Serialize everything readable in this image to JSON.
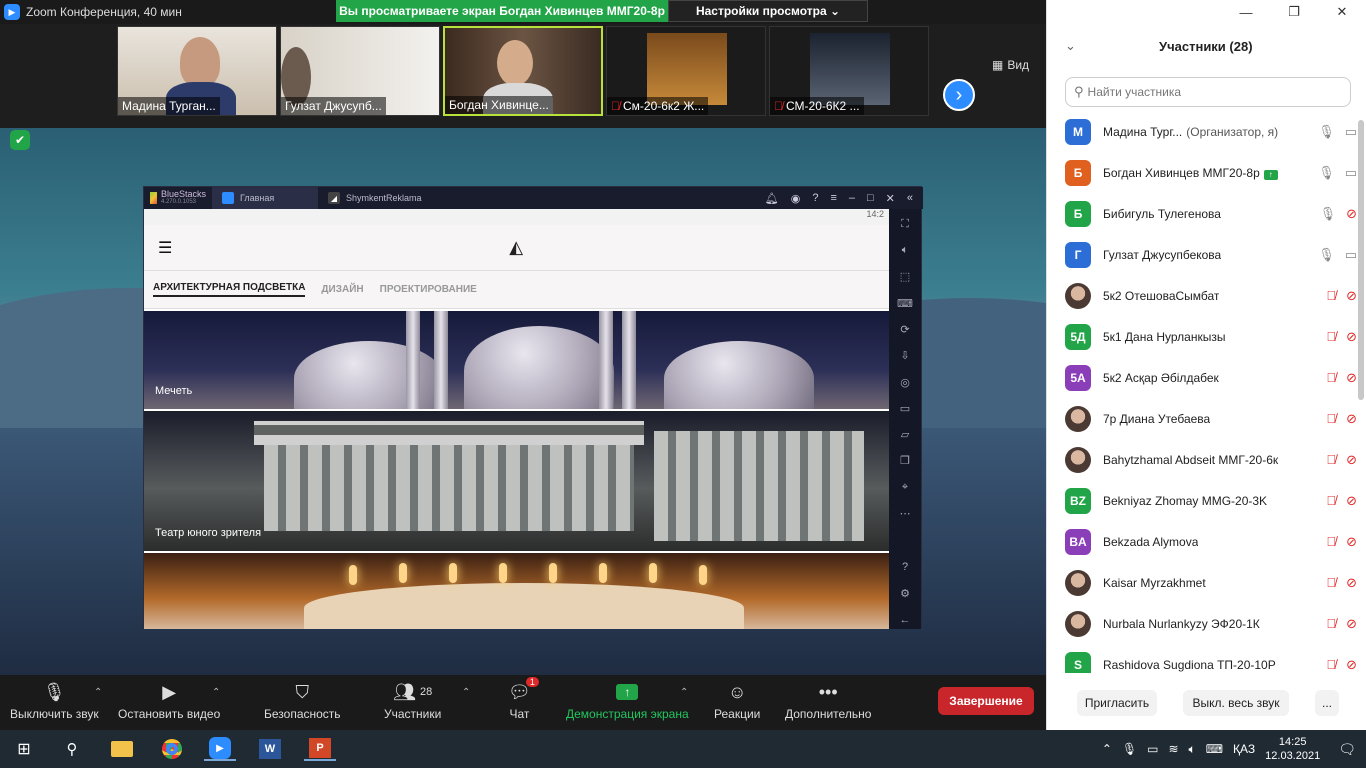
{
  "window": {
    "title": "Zoom Конференция, 40 мин"
  },
  "banner": {
    "viewing": "Вы просматриваете экран Богдан Хивинцев ММГ20-8р",
    "view_settings": "Настройки просмотра ⌄"
  },
  "strip": {
    "thumbs": [
      {
        "name": "Мадина Турган...",
        "muted": false
      },
      {
        "name": "Гулзат Джусупб...",
        "muted": false
      },
      {
        "name": "Богдан Хивинце...",
        "muted": false
      },
      {
        "name": "См-20-6к2 Ж...",
        "muted": true
      },
      {
        "name": "СМ-20-6К2 ...",
        "muted": true
      }
    ],
    "view_label": "Вид"
  },
  "bluestacks": {
    "brand": "BlueStacks",
    "version": "4.270.0.1053",
    "tabs": [
      "Главная",
      "ShymkentReklama"
    ],
    "status_time": "14:2",
    "app_tabs": [
      "АРХИТЕКТУРНАЯ ПОДСВЕТКА",
      "ДИЗАЙН",
      "ПРОЕКТИРОВАНИЕ"
    ],
    "cards": [
      "Мечеть",
      "Театр юного зрителя"
    ]
  },
  "toolbar": {
    "mute": "Выключить звук",
    "video": "Остановить видео",
    "security": "Безопасность",
    "participants": "Участники",
    "participants_count": "28",
    "chat": "Чат",
    "chat_badge": "1",
    "share": "Демонстрация экрана",
    "reactions": "Реакции",
    "more": "Дополнительно",
    "end": "Завершение"
  },
  "panel": {
    "title": "Участники (28)",
    "search_placeholder": "Найти участника",
    "participants": [
      {
        "initial": "М",
        "color": "#2d6ed6",
        "name": "Мадина Тург...",
        "role": "(Организатор, я)",
        "mic": "on",
        "cam": "on"
      },
      {
        "initial": "Б",
        "color": "#e0601f",
        "name": "Богдан Хивинцев ММГ20-8р",
        "role": "",
        "sharing": true,
        "mic": "on",
        "cam": "on"
      },
      {
        "initial": "Б",
        "color": "#22a548",
        "name": "Бибигуль Тулегенова",
        "role": "",
        "mic": "on",
        "cam": "off"
      },
      {
        "initial": "Г",
        "color": "#2d6ed6",
        "name": "Гулзат Джусупбекова",
        "role": "",
        "mic": "on",
        "cam": "on"
      },
      {
        "initial": "",
        "color": "photo",
        "name": "5к2 ОтешоваСымбат",
        "role": "",
        "mic": "off",
        "cam": "off"
      },
      {
        "initial": "5Д",
        "color": "#22a548",
        "name": "5к1 Дана Нурланкызы",
        "role": "",
        "mic": "off",
        "cam": "off"
      },
      {
        "initial": "5А",
        "color": "#8a3fb8",
        "name": "5к2  Асқар Әбілдабек",
        "role": "",
        "mic": "off",
        "cam": "off"
      },
      {
        "initial": "",
        "color": "photo",
        "name": "7р Диана Утебаева",
        "role": "",
        "mic": "off",
        "cam": "off"
      },
      {
        "initial": "",
        "color": "photo",
        "name": "Bahytzhamal Abdseit ММГ-20-6к",
        "role": "",
        "mic": "off",
        "cam": "off"
      },
      {
        "initial": "BZ",
        "color": "#22a548",
        "name": "Bekniyaz Zhomay MMG-20-3K",
        "role": "",
        "mic": "off",
        "cam": "off"
      },
      {
        "initial": "BA",
        "color": "#8a3fb8",
        "name": "Bekzada Alymova",
        "role": "",
        "mic": "off",
        "cam": "off"
      },
      {
        "initial": "",
        "color": "photo",
        "name": "Kaisar Myrzakhmet",
        "role": "",
        "mic": "off",
        "cam": "off"
      },
      {
        "initial": "",
        "color": "photo",
        "name": "Nurbala Nurlankyzy ЭФ20-1К",
        "role": "",
        "mic": "off",
        "cam": "off"
      },
      {
        "initial": "S",
        "color": "#22a548",
        "name": "Rashidova Sugdiona ТП-20-10Р",
        "role": "",
        "mic": "off",
        "cam": "off"
      }
    ],
    "invite": "Пригласить",
    "mute_all": "Выкл. весь звук",
    "more": "..."
  },
  "taskbar": {
    "lang": "ҚАЗ",
    "time": "14:25",
    "date": "12.03.2021"
  }
}
